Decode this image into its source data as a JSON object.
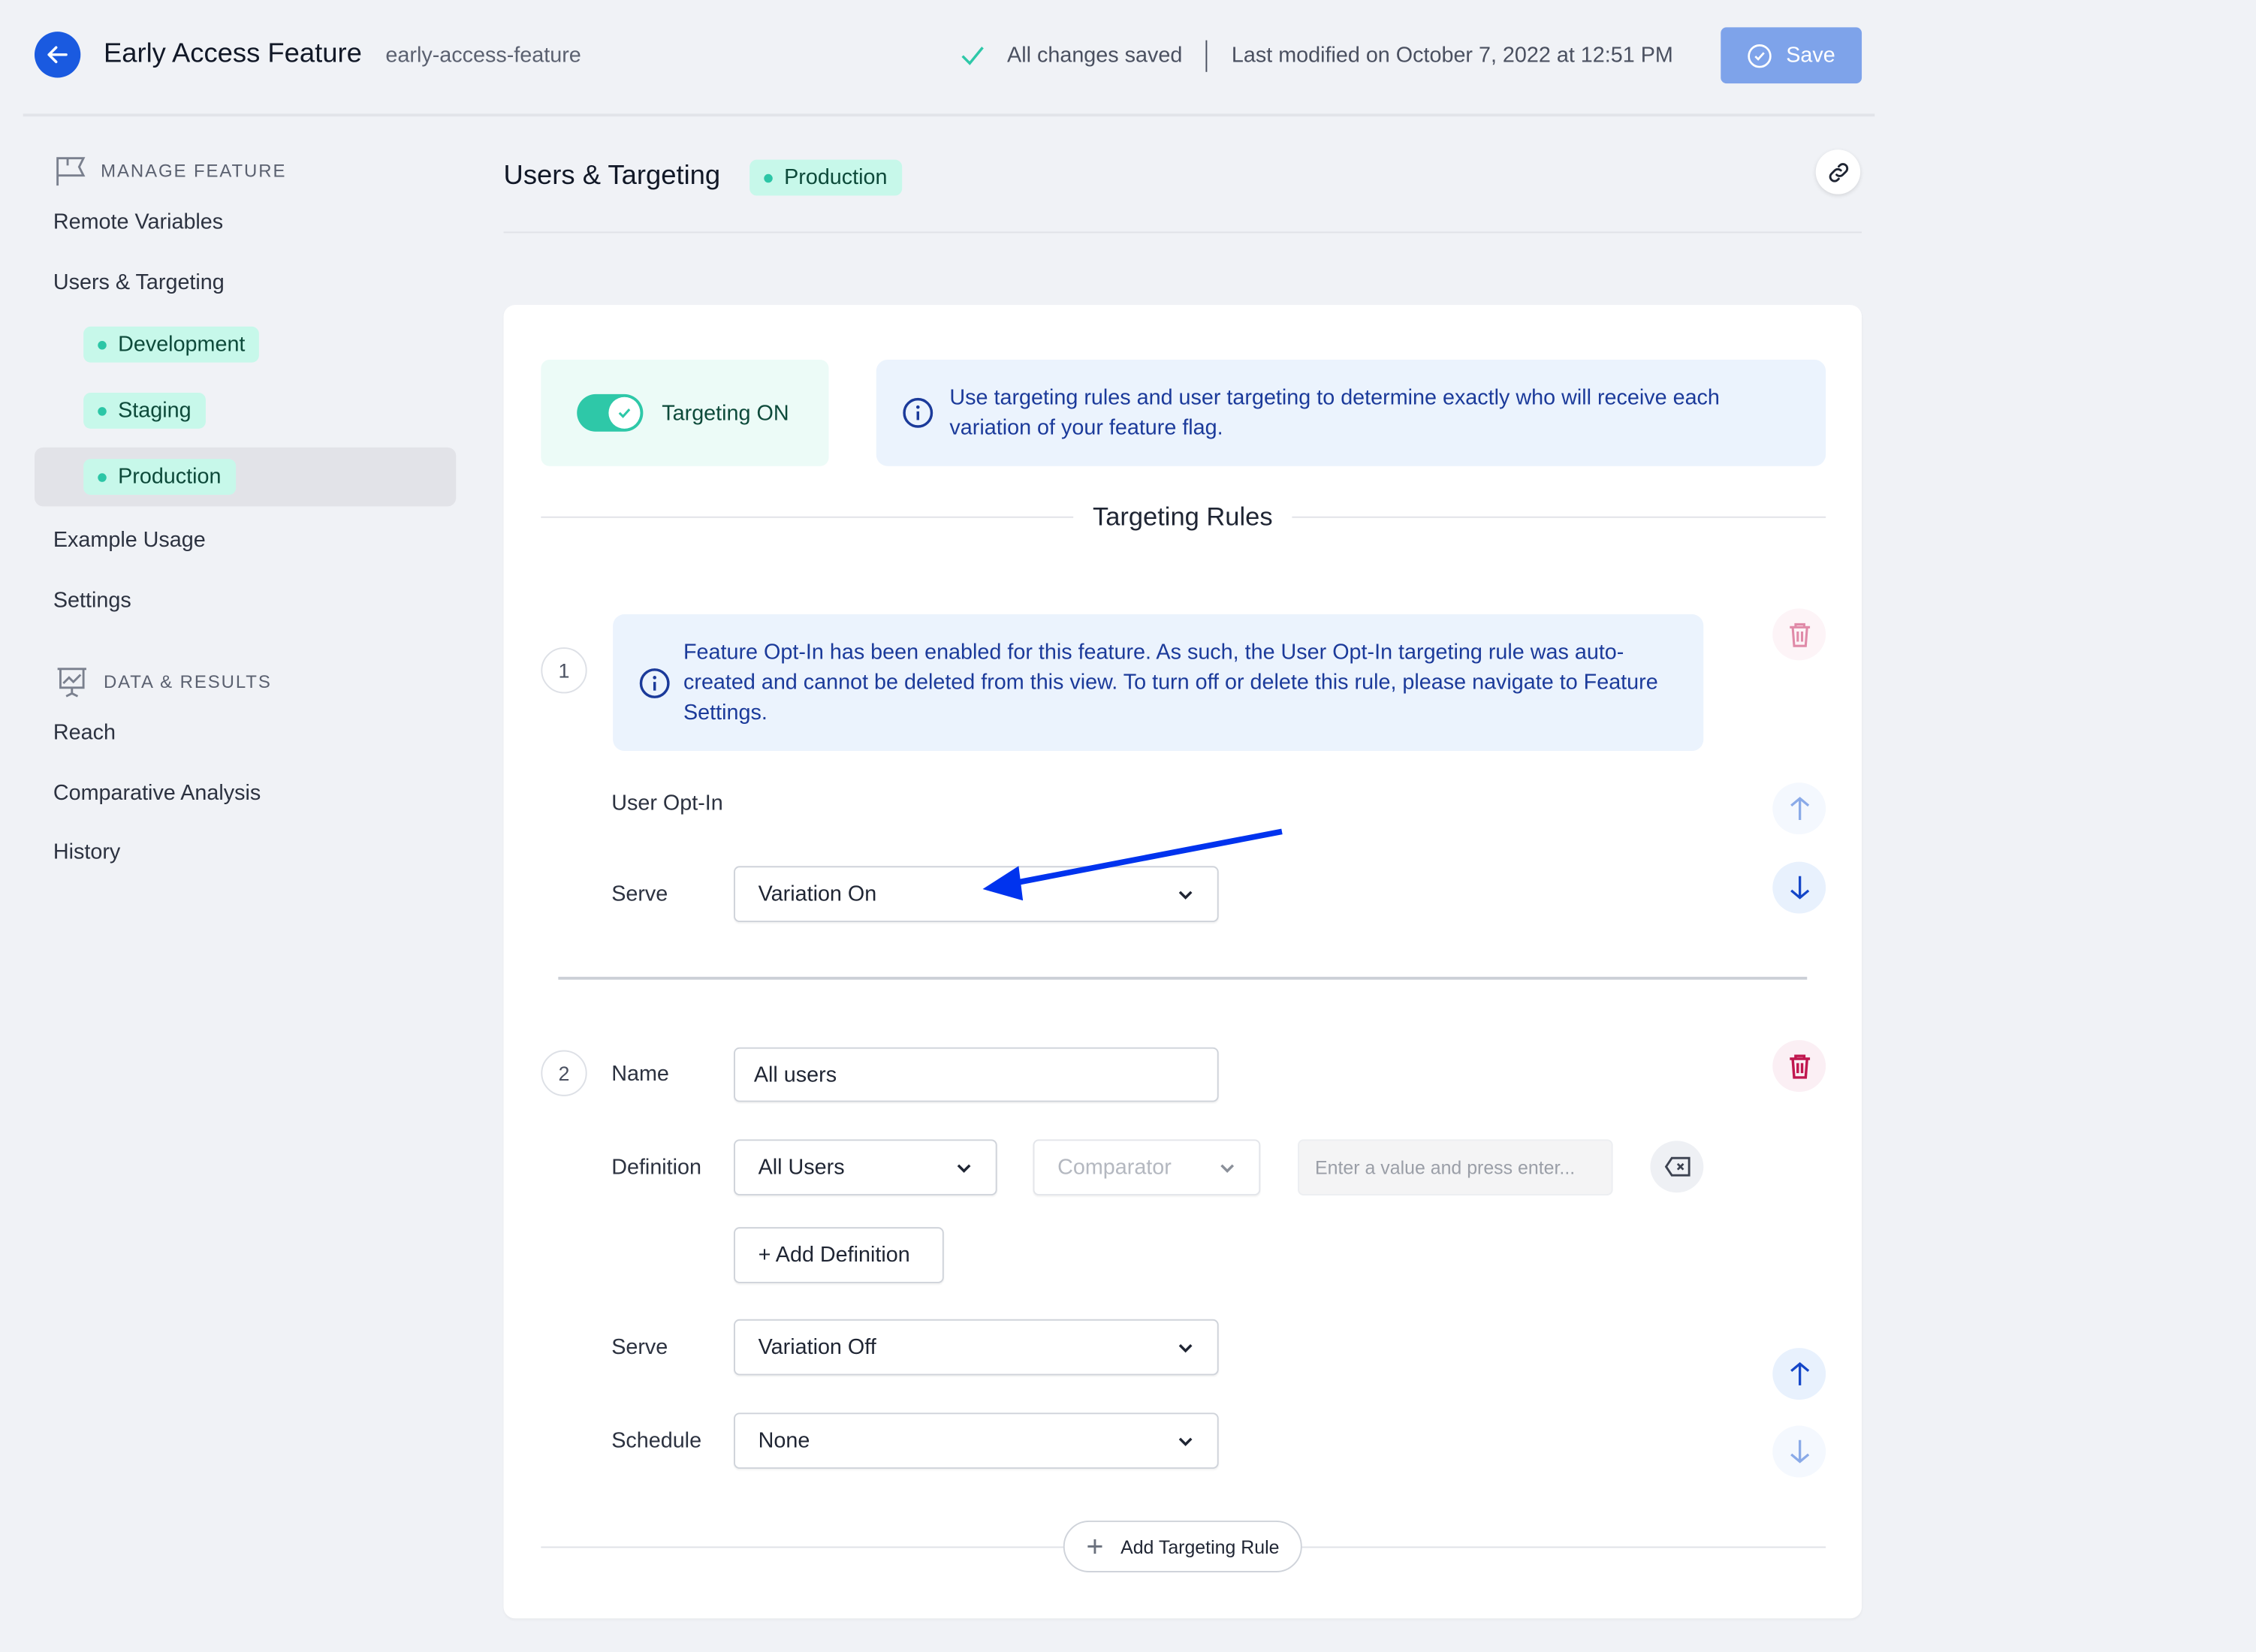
{
  "header": {
    "title": "Early Access Feature",
    "slug": "early-access-feature",
    "save_status": "All changes saved",
    "last_modified": "Last modified on October 7, 2022 at 12:51 PM",
    "save_label": "Save"
  },
  "sidebar": {
    "manage_section": "MANAGE FEATURE",
    "items": [
      {
        "label": "Remote Variables"
      },
      {
        "label": "Users & Targeting"
      },
      {
        "label": "Development"
      },
      {
        "label": "Staging"
      },
      {
        "label": "Production",
        "active": true
      },
      {
        "label": "Example Usage"
      },
      {
        "label": "Settings"
      }
    ],
    "data_section": "DATA & RESULTS",
    "data_items": [
      {
        "label": "Reach"
      },
      {
        "label": "Comparative Analysis"
      },
      {
        "label": "History"
      }
    ]
  },
  "main": {
    "title": "Users & Targeting",
    "env_badge": "Production",
    "targeting_toggle": {
      "label": "Targeting ON",
      "on": true
    },
    "targeting_info": "Use targeting rules and user targeting to determine exactly who will receive each variation of your feature flag.",
    "rules_heading": "Targeting Rules",
    "rules": [
      {
        "number": "1",
        "notice": "Feature Opt-In has been enabled for this feature. As such, the User Opt-In targeting rule was auto-created and cannot be deleted from this view. To turn off or delete this rule, please navigate to Feature Settings.",
        "name": "User Opt-In",
        "serve_label": "Serve",
        "serve_value": "Variation On"
      },
      {
        "number": "2",
        "name_label": "Name",
        "name_value": "All users",
        "definition_label": "Definition",
        "definition_value": "All Users",
        "comparator_placeholder": "Comparator",
        "value_placeholder": "Enter a value and press enter...",
        "add_definition": "+ Add Definition",
        "serve_label": "Serve",
        "serve_value": "Variation Off",
        "schedule_label": "Schedule",
        "schedule_value": "None"
      }
    ],
    "add_rule_label": "Add Targeting Rule"
  },
  "colors": {
    "primary": "#1a5ae0",
    "save_disabled": "#7ea3ea",
    "badge_bg": "#c7f8ea",
    "toggle_on": "#2ec8a8",
    "info_bg": "#ebf3fd",
    "info_text": "#1b3a9a",
    "delete": "#c0174f",
    "annotation_arrow": "#0033ee"
  }
}
